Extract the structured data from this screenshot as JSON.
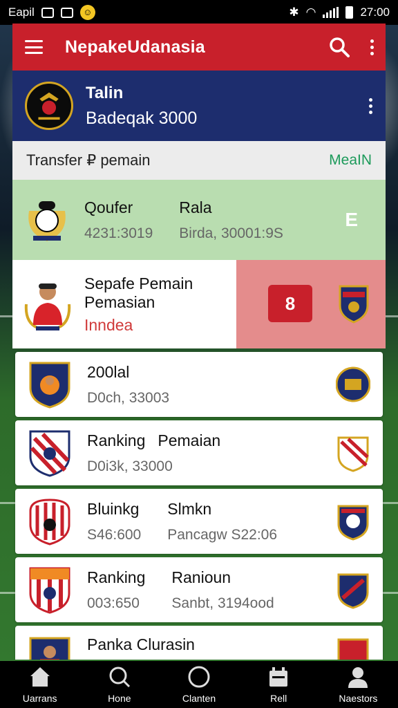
{
  "status_bar": {
    "carrier": "Eapil",
    "time": "27:00"
  },
  "app_bar": {
    "title": "NepakeUdanasia"
  },
  "team_header": {
    "name": "Talin",
    "subtitle": "Badeqak 3000"
  },
  "section": {
    "title": "Transfer ₽ pemain",
    "link": "MeaIN"
  },
  "rows": [
    {
      "variant": "green",
      "col1_main": "Qoufer",
      "col1_sub": "4231:3019",
      "col2_main": "Rala",
      "col2_sub": "Birda, 30001:9S",
      "trail_glyph": "E"
    },
    {
      "variant": "swipe",
      "line1": "Sepafe Pemain",
      "line2": "Pemasian",
      "tag": "Inndea",
      "button_glyph": "8"
    },
    {
      "variant": "card",
      "col1_main": "200lal",
      "col1_sub": "D0ch, 33003"
    },
    {
      "variant": "card",
      "col1_main": "Ranking",
      "col2_main": "Pemaian",
      "col1_sub": "D0i3k, 33000"
    },
    {
      "variant": "card",
      "col1_main": "Bluinkg",
      "col1_sub": "S46:600",
      "col2_main": "Slmkn",
      "col2_sub": "Pancagw S22:06"
    },
    {
      "variant": "card",
      "col1_main": "Ranking",
      "col1_sub": "003:650",
      "col2_main": "Ranioun",
      "col2_sub": "Sanbt, 3194ood"
    },
    {
      "variant": "card",
      "col1_main": "Panka Clurasin"
    }
  ],
  "bottom_nav": [
    {
      "label": "Uarrans",
      "icon": "home-icon"
    },
    {
      "label": "Hone",
      "icon": "search-icon"
    },
    {
      "label": "Clanten",
      "icon": "circle-icon"
    },
    {
      "label": "Rell",
      "icon": "calendar-icon"
    },
    {
      "label": "Naestors",
      "icon": "person-icon"
    }
  ],
  "colors": {
    "app_bar": "#c8202b",
    "team_header": "#1d2d6e",
    "accent_green": "#1c9a5a",
    "row_green": "#b9ddb0",
    "swipe_red": "#e48c8c"
  }
}
